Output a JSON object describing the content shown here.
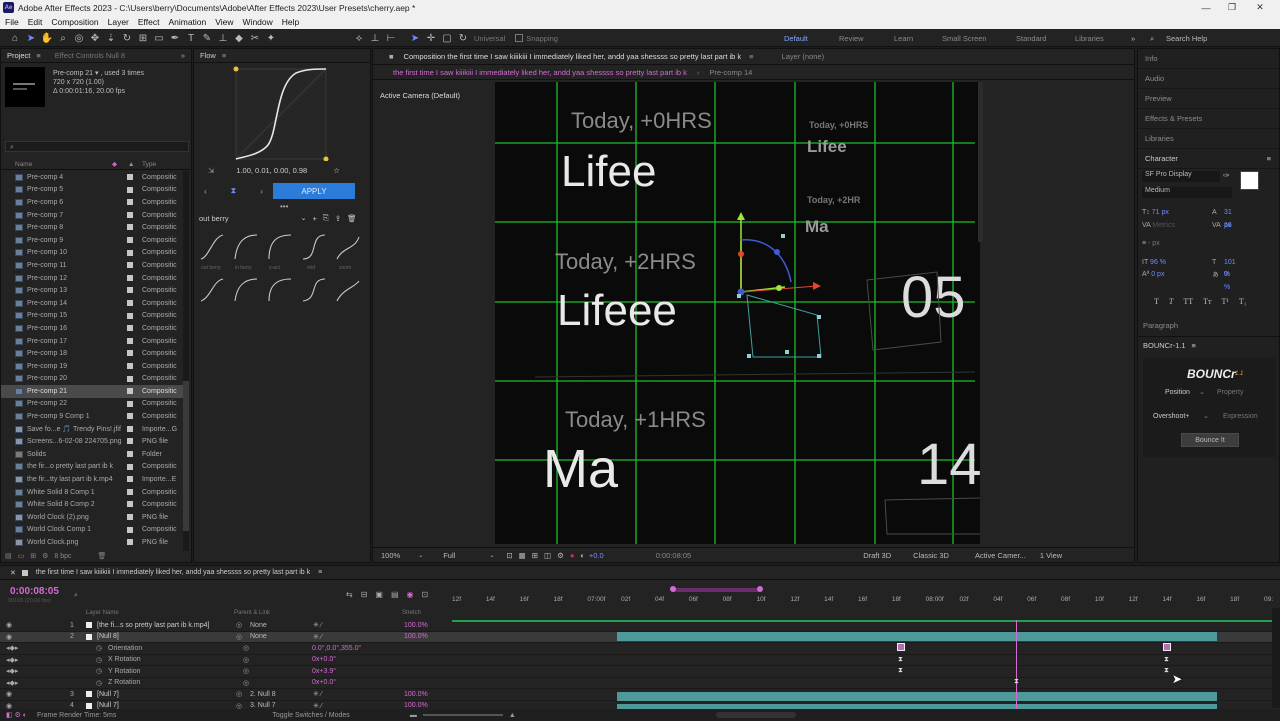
{
  "window": {
    "title": "Adobe After Effects 2023 - C:\\Users\\berry\\Documents\\Adobe\\After Effects 2023\\User Presets\\cherry.aep *"
  },
  "menu": [
    "File",
    "Edit",
    "Composition",
    "Layer",
    "Effect",
    "Animation",
    "View",
    "Window",
    "Help"
  ],
  "toolbar": {
    "universal": "Universal",
    "snapping": "Snapping",
    "workspaces": [
      "Default",
      "Review",
      "Learn",
      "Small Screen",
      "Standard",
      "Libraries"
    ],
    "search": "Search Help"
  },
  "project": {
    "tab": "Project",
    "effect_tab": "Effect Controls Null 8",
    "selected_name": "Pre-comp 21 ▾ , used 3 times",
    "info1": "720 x 720 (1.00)",
    "info2": "Δ 0:00:01:16, 20.00 fps",
    "col_name": "Name",
    "col_type": "Type",
    "items": [
      {
        "name": "Pre-comp 4",
        "type": "Compositic"
      },
      {
        "name": "Pre-comp 5",
        "type": "Compositic"
      },
      {
        "name": "Pre-comp 6",
        "type": "Compositic"
      },
      {
        "name": "Pre-comp 7",
        "type": "Compositic"
      },
      {
        "name": "Pre-comp 8",
        "type": "Compositic"
      },
      {
        "name": "Pre-comp 9",
        "type": "Compositic"
      },
      {
        "name": "Pre-comp 10",
        "type": "Compositic"
      },
      {
        "name": "Pre-comp 11",
        "type": "Compositic"
      },
      {
        "name": "Pre-comp 12",
        "type": "Compositic"
      },
      {
        "name": "Pre-comp 13",
        "type": "Compositic"
      },
      {
        "name": "Pre-comp 14",
        "type": "Compositic"
      },
      {
        "name": "Pre-comp 15",
        "type": "Compositic"
      },
      {
        "name": "Pre-comp 16",
        "type": "Compositic"
      },
      {
        "name": "Pre-comp 17",
        "type": "Compositic"
      },
      {
        "name": "Pre-comp 18",
        "type": "Compositic"
      },
      {
        "name": "Pre-comp 19",
        "type": "Compositic"
      },
      {
        "name": "Pre-comp 20",
        "type": "Compositic"
      },
      {
        "name": "Pre-comp 21",
        "type": "Compositic"
      },
      {
        "name": "Pre-comp 22",
        "type": "Compositic"
      },
      {
        "name": "Pre-comp 9 Comp 1",
        "type": "Compositic"
      },
      {
        "name": "Save fo...e 🎵 Trendy Pins!.jfif",
        "type": "Importe...G"
      },
      {
        "name": "Screens...6-02-08 224705.png",
        "type": "PNG file"
      },
      {
        "name": "Solids",
        "type": "Folder"
      },
      {
        "name": "the fir...o pretty last part ib k",
        "type": "Compositic"
      },
      {
        "name": "the fir...tty last part ib k.mp4",
        "type": "Importe...E"
      },
      {
        "name": "White Solid 8 Comp 1",
        "type": "Compositic"
      },
      {
        "name": "White Solid 8 Comp 2",
        "type": "Compositic"
      },
      {
        "name": "World Clock (2).png",
        "type": "PNG file"
      },
      {
        "name": "World Clock Comp 1",
        "type": "Compositic"
      },
      {
        "name": "World Clock.png",
        "type": "PNG file"
      }
    ],
    "bpc": "8 bpc"
  },
  "flow": {
    "tab": "Flow",
    "values": "1.00, 0.01, 0.00, 0.98",
    "apply": "APPLY",
    "preset": "out berry",
    "labels": [
      "out berry",
      "in berry",
      "y-act",
      "mid",
      "zoom"
    ]
  },
  "comp": {
    "tab_title": "Composition the first time I saw kiiikiii I immediately liked her, andd yaa shessss so pretty last part ib k",
    "layer_tab": "Layer (none)",
    "breadcrumb1": "the first time I saw kiiikiii I immediately liked her, andd yaa shessss so pretty last part ib k",
    "breadcrumb2": "Pre-comp 14",
    "camera": "Active Camera (Default)",
    "texts": {
      "t1": "Today, +0HRS",
      "t2": "Lifee",
      "t3": "Today, +2HRS",
      "t4": "Lifeee",
      "t5": "Today, +1HRS",
      "t6": "Ma",
      "t7": "05",
      "t8": "14",
      "s1": "Today, +0HRS",
      "s2": "Lifee",
      "s3": "Today, +2HR",
      "s4": "Ma"
    },
    "footer": {
      "zoom": "100%",
      "res": "Full",
      "exposure": "+0.0",
      "time": "0:00:08:05",
      "draft": "Draft 3D",
      "renderer": "Classic 3D",
      "camera": "Active Camer...",
      "views": "1 View"
    }
  },
  "right": {
    "items": [
      "Info",
      "Audio",
      "Preview",
      "Effects & Presets",
      "Libraries",
      "Character"
    ],
    "font": "SF Pro Display",
    "weight": "Medium",
    "size": "71 px",
    "leading": "31 px",
    "kerning": "Metrics",
    "tracking": "16",
    "indent": "- px",
    "vscale": "96 %",
    "hscale": "101 %",
    "baseline": "0 px",
    "tsume": "0 %",
    "paragraph": "Paragraph",
    "plugin": "BOUNCr-1.1",
    "logo": "BOUNCr",
    "logo_ver": "1.1",
    "position": "Position",
    "property": "Property",
    "overshoot": "Overshoot+",
    "expression": "Expression",
    "bounce": "Bounce It"
  },
  "timeline": {
    "tab": "the first time I saw kiiikiii I immediately liked her, andd yaa shessss so pretty last part ib k",
    "time": "0:00:08:05",
    "frames": "00165 (20.00 fps)",
    "col_layer": "Layer Name",
    "col_parent": "Parent & Link",
    "col_stretch": "Stretch",
    "ruler": [
      "12f",
      "14f",
      "16f",
      "18f",
      "07:00f",
      "02f",
      "04f",
      "06f",
      "08f",
      "10f",
      "12f",
      "14f",
      "16f",
      "18f",
      "08:00f",
      "02f",
      "04f",
      "06f",
      "08f",
      "10f",
      "12f",
      "14f",
      "16f",
      "18f",
      "09:"
    ],
    "layers": [
      {
        "num": "1",
        "name": "[the fi...s so pretty last part ib k.mp4]",
        "parent": "None",
        "stretch": "100.0%"
      },
      {
        "num": "2",
        "name": "[Null 8]",
        "parent": "None",
        "stretch": "100.0%"
      },
      {
        "num": "",
        "name": "Orientation",
        "parent": "",
        "stretch": "",
        "val": "0.0°,0.0°,355.0°"
      },
      {
        "num": "",
        "name": "X Rotation",
        "parent": "",
        "stretch": "",
        "val": "0x+0.0°"
      },
      {
        "num": "",
        "name": "Y Rotation",
        "parent": "",
        "stretch": "",
        "val": "0x+3.9°"
      },
      {
        "num": "",
        "name": "Z Rotation",
        "parent": "",
        "stretch": "",
        "val": "0x+0.0°"
      },
      {
        "num": "3",
        "name": "[Null 7]",
        "parent": "2. Null 8",
        "stretch": "100.0%"
      },
      {
        "num": "4",
        "name": "[Null 7]",
        "parent": "3. Null 7",
        "stretch": "100.0%"
      }
    ],
    "render_time": "Frame Render Time: 5ms",
    "toggle": "Toggle Switches / Modes"
  }
}
